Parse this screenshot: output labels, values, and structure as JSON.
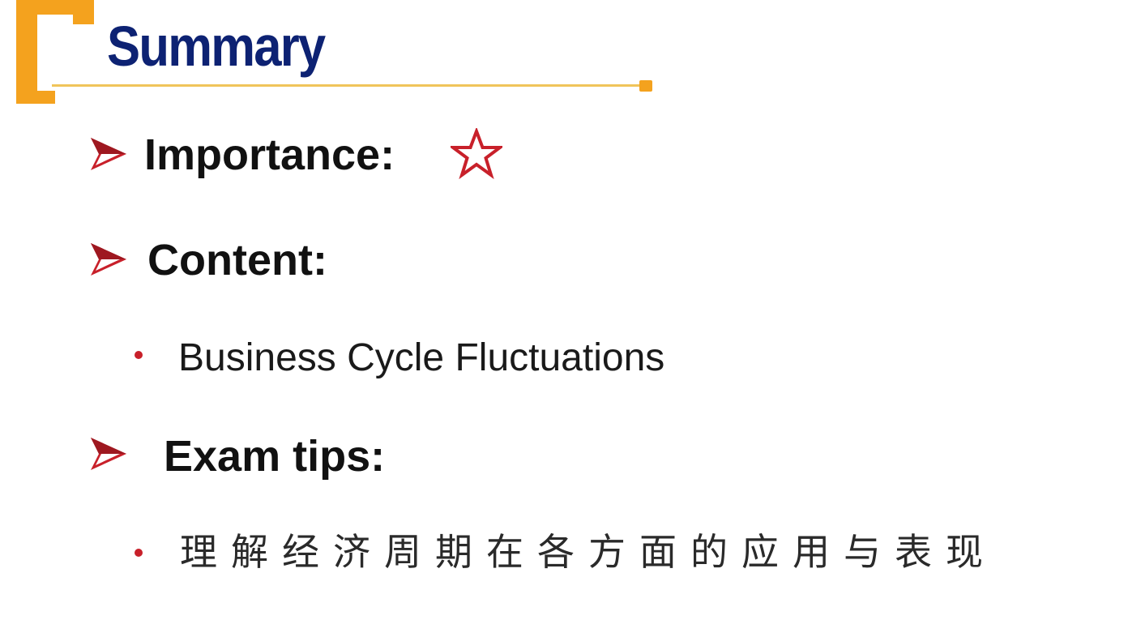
{
  "slide": {
    "title": "Summary",
    "items": [
      {
        "label": "Importance:",
        "icon": "star-outline-icon"
      },
      {
        "label": "Content:",
        "sub": "Business Cycle Fluctuations"
      },
      {
        "label": "Exam tips:",
        "sub": "理解经济周期在各方面的应用与表现"
      }
    ]
  },
  "colors": {
    "title": "#0d2273",
    "accent_orange": "#f4a21e",
    "arrow_red": "#c8202a",
    "text": "#111111"
  }
}
